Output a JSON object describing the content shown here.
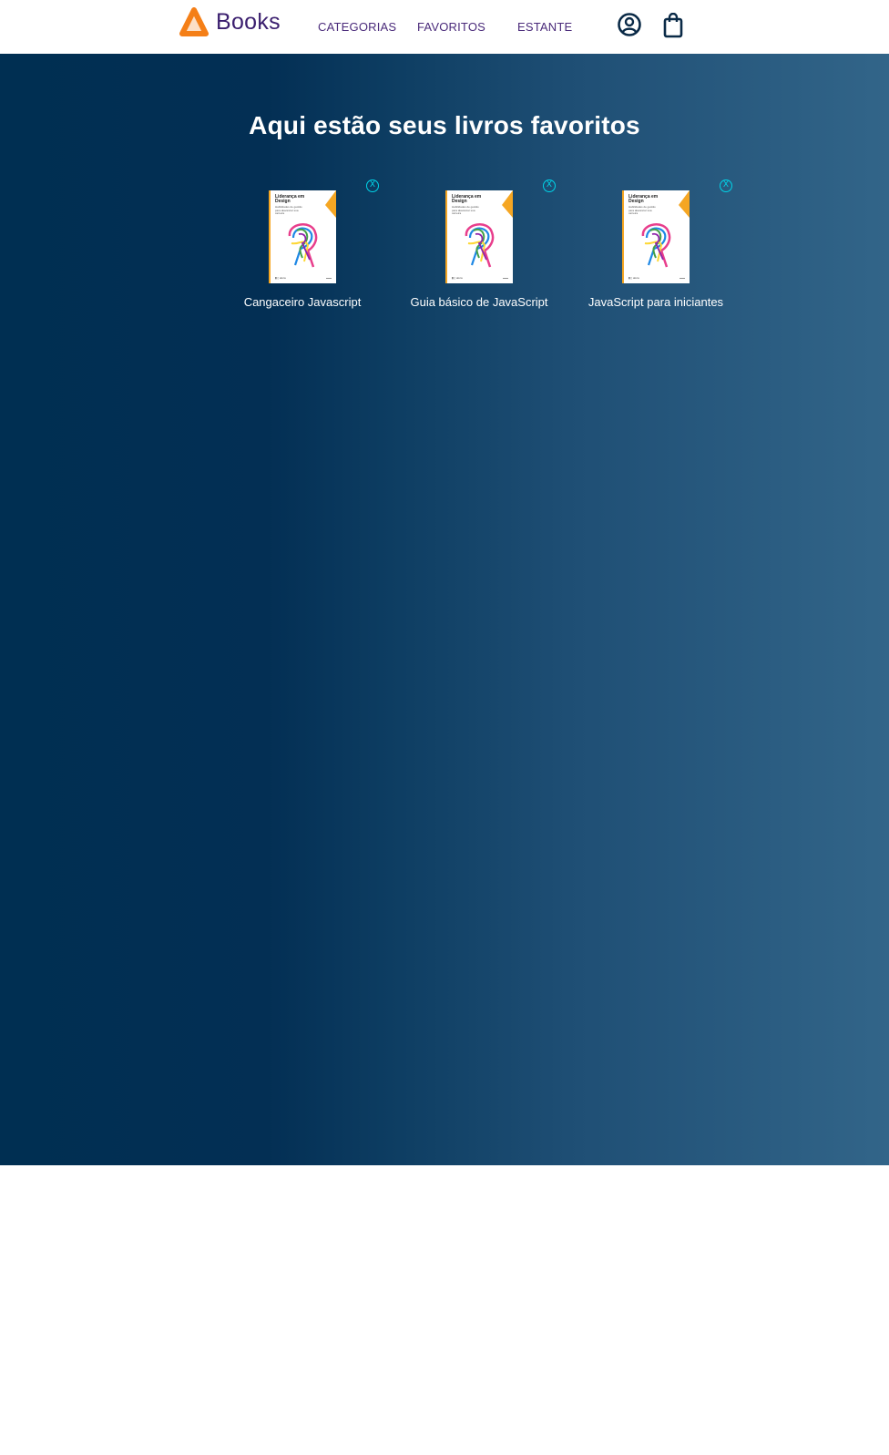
{
  "header": {
    "logo_text": "Books",
    "nav": [
      {
        "label": "CATEGORIAS"
      },
      {
        "label": "FAVORITOS"
      },
      {
        "label": "ESTANTE"
      }
    ],
    "icons": [
      "user-circle-icon",
      "shopping-bag-icon"
    ]
  },
  "main": {
    "title": "Aqui estão seus livros favoritos",
    "books": [
      {
        "title": "Cangaceiro Javascript",
        "remove_label": "X",
        "cover_title": "Liderança em Design",
        "cover_subtitle": "Habilidades de gestão para alavancar sua carreira"
      },
      {
        "title": "Guia básico de JavaScript",
        "remove_label": "X",
        "cover_title": "Liderança em Design",
        "cover_subtitle": "Habilidades de gestão para alavancar sua carreira"
      },
      {
        "title": "JavaScript para iniciantes",
        "remove_label": "X",
        "cover_title": "Liderança em Design",
        "cover_subtitle": "Habilidades de gestão para alavancar sua carreira"
      }
    ]
  },
  "colors": {
    "brand_orange": "#f57f17",
    "nav_text": "#4a2a7a",
    "remove_accent": "#00d4e8",
    "gradient_start": "#002f52",
    "gradient_end": "#326589"
  }
}
